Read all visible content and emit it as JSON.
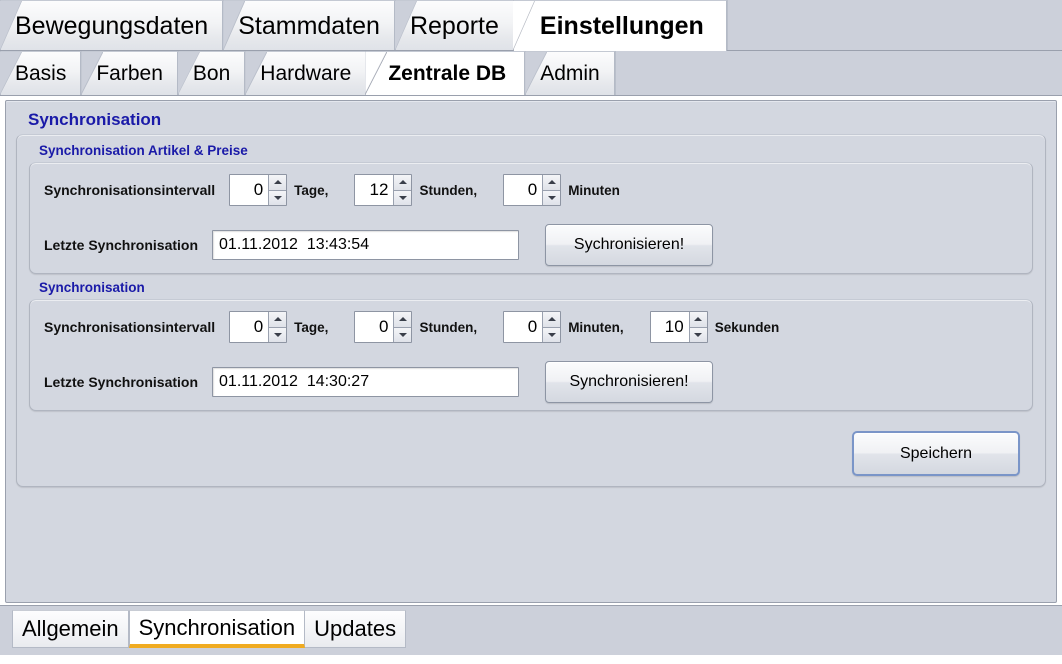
{
  "top_tabs": [
    {
      "label": "Bewegungsdaten",
      "active": false
    },
    {
      "label": "Stammdaten",
      "active": false
    },
    {
      "label": "Reporte",
      "active": false
    },
    {
      "label": "Einstellungen",
      "active": true
    }
  ],
  "sub_tabs": [
    {
      "label": "Basis",
      "active": false
    },
    {
      "label": "Farben",
      "active": false
    },
    {
      "label": "Bon",
      "active": false
    },
    {
      "label": "Hardware",
      "active": false
    },
    {
      "label": "Zentrale DB",
      "active": true
    },
    {
      "label": "Admin",
      "active": false
    }
  ],
  "panel": {
    "title": "Synchronisation",
    "groups": [
      {
        "title": "Synchronisation Artikel & Preise",
        "interval_label": "Synchronisationsintervall",
        "spinners": [
          {
            "value": "0",
            "unit": "Tage,"
          },
          {
            "value": "12",
            "unit": "Stunden,"
          },
          {
            "value": "0",
            "unit": "Minuten"
          }
        ],
        "last_sync_label": "Letzte Synchronisation",
        "last_sync_value": "01.11.2012  13:43:54",
        "sync_button": "Sychronisieren!"
      },
      {
        "title": "Synchronisation",
        "interval_label": "Synchronisationsintervall",
        "spinners": [
          {
            "value": "0",
            "unit": "Tage,"
          },
          {
            "value": "0",
            "unit": "Stunden,"
          },
          {
            "value": "0",
            "unit": "Minuten,"
          },
          {
            "value": "10",
            "unit": "Sekunden"
          }
        ],
        "last_sync_label": "Letzte Synchronisation",
        "last_sync_value": "01.11.2012  14:30:27",
        "sync_button": "Synchronisieren!"
      }
    ],
    "save_button": "Speichern"
  },
  "bottom_tabs": [
    {
      "label": "Allgemein",
      "active": false
    },
    {
      "label": "Synchronisation",
      "active": true
    },
    {
      "label": "Updates",
      "active": false
    }
  ],
  "colors": {
    "heading_blue": "#1a1aa8",
    "panel_bg": "#d3d7e0",
    "tabstrip_bg": "#ccd0da",
    "active_tab_underline": "#f0ab20",
    "focus_border": "#7a95c8"
  }
}
